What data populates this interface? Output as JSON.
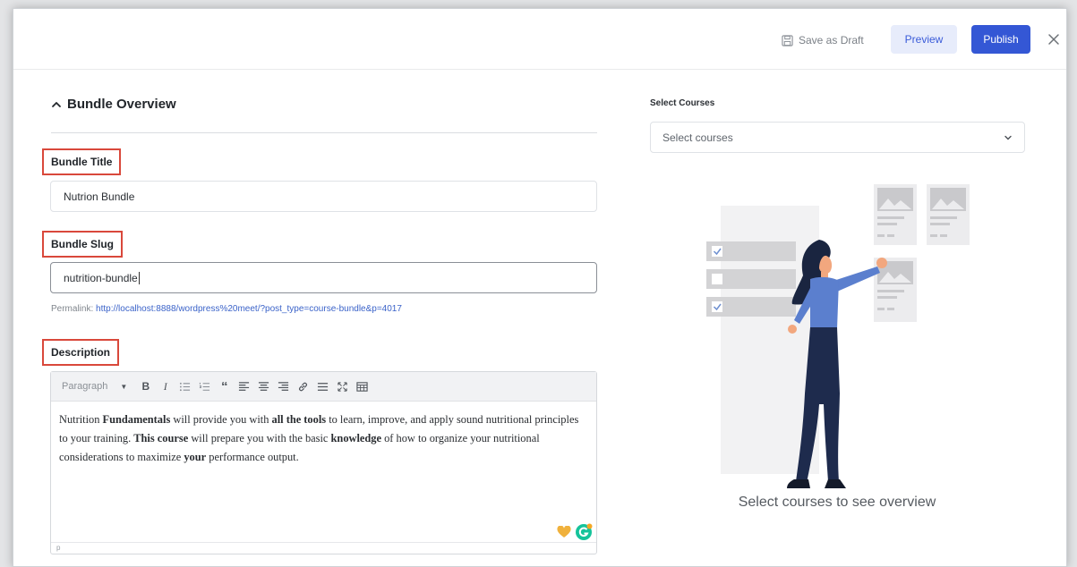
{
  "header": {
    "save_draft_label": "Save as Draft",
    "preview_label": "Preview",
    "publish_label": "Publish"
  },
  "overview": {
    "section_title": "Bundle Overview",
    "title_label": "Bundle Title",
    "title_value": "Nutrion Bundle",
    "slug_label": "Bundle Slug",
    "slug_value": "nutrition-bundle",
    "permalink_prefix": "Permalink:",
    "permalink_url": "http://localhost:8888/wordpress%20meet/?post_type=course-bundle&p=4017",
    "description_label": "Description"
  },
  "editor": {
    "format_value": "Paragraph",
    "statusbar_path": "p",
    "content_parts": [
      {
        "text": "Nutrition ",
        "bold": false
      },
      {
        "text": "Fundamentals",
        "bold": true
      },
      {
        "text": " will provide you with ",
        "bold": false
      },
      {
        "text": "all the tools",
        "bold": true
      },
      {
        "text": " to learn, improve, and apply sound ",
        "bold": false
      },
      {
        "text": "nutritional principles to your training. ",
        "bold": false
      },
      {
        "text": "This course",
        "bold": true
      },
      {
        "text": " will prepare you with the basic ",
        "bold": false
      },
      {
        "text": "knowledge",
        "bold": true
      },
      {
        "text": " of how to organize your nutritional considerations to maximize ",
        "bold": false
      },
      {
        "text": "your",
        "bold": true
      },
      {
        "text": " performance output.",
        "bold": false
      }
    ]
  },
  "courses": {
    "label": "Select Courses",
    "placeholder": "Select courses",
    "empty_message": "Select courses to see overview"
  },
  "colors": {
    "accent": "#3457d5",
    "highlight_border": "#d9483b",
    "figure_shirt": "#5b7fce",
    "figure_pants": "#1e2b4d"
  }
}
